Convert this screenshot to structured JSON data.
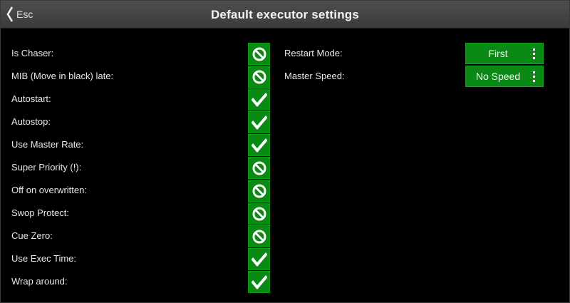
{
  "header": {
    "back_label": "Esc",
    "title": "Default executor settings"
  },
  "settings": [
    {
      "label": "Is Chaser:",
      "state": "off",
      "icon": "prohibited-icon"
    },
    {
      "label": "MIB (Move in black) late:",
      "state": "off",
      "icon": "prohibited-icon"
    },
    {
      "label": "Autostart:",
      "state": "on",
      "icon": "checkmark-icon"
    },
    {
      "label": "Autostop:",
      "state": "on",
      "icon": "checkmark-icon"
    },
    {
      "label": "Use Master Rate:",
      "state": "on",
      "icon": "checkmark-icon"
    },
    {
      "label": "Super Priority (!):",
      "state": "off",
      "icon": "prohibited-icon"
    },
    {
      "label": "Off on overwritten:",
      "state": "off",
      "icon": "prohibited-icon"
    },
    {
      "label": "Swop Protect:",
      "state": "off",
      "icon": "prohibited-icon"
    },
    {
      "label": "Cue Zero:",
      "state": "off",
      "icon": "prohibited-icon"
    },
    {
      "label": "Use Exec Time:",
      "state": "on",
      "icon": "checkmark-icon"
    },
    {
      "label": "Wrap around:",
      "state": "on",
      "icon": "checkmark-icon"
    }
  ],
  "options": [
    {
      "label": "Restart Mode:",
      "value": "First"
    },
    {
      "label": "Master Speed:",
      "value": "No Speed"
    }
  ],
  "colors": {
    "toggle_bg": "#0a8a14",
    "select_bg": "#0a8a14",
    "titlebar_bg": "#444444",
    "background": "#000000"
  }
}
